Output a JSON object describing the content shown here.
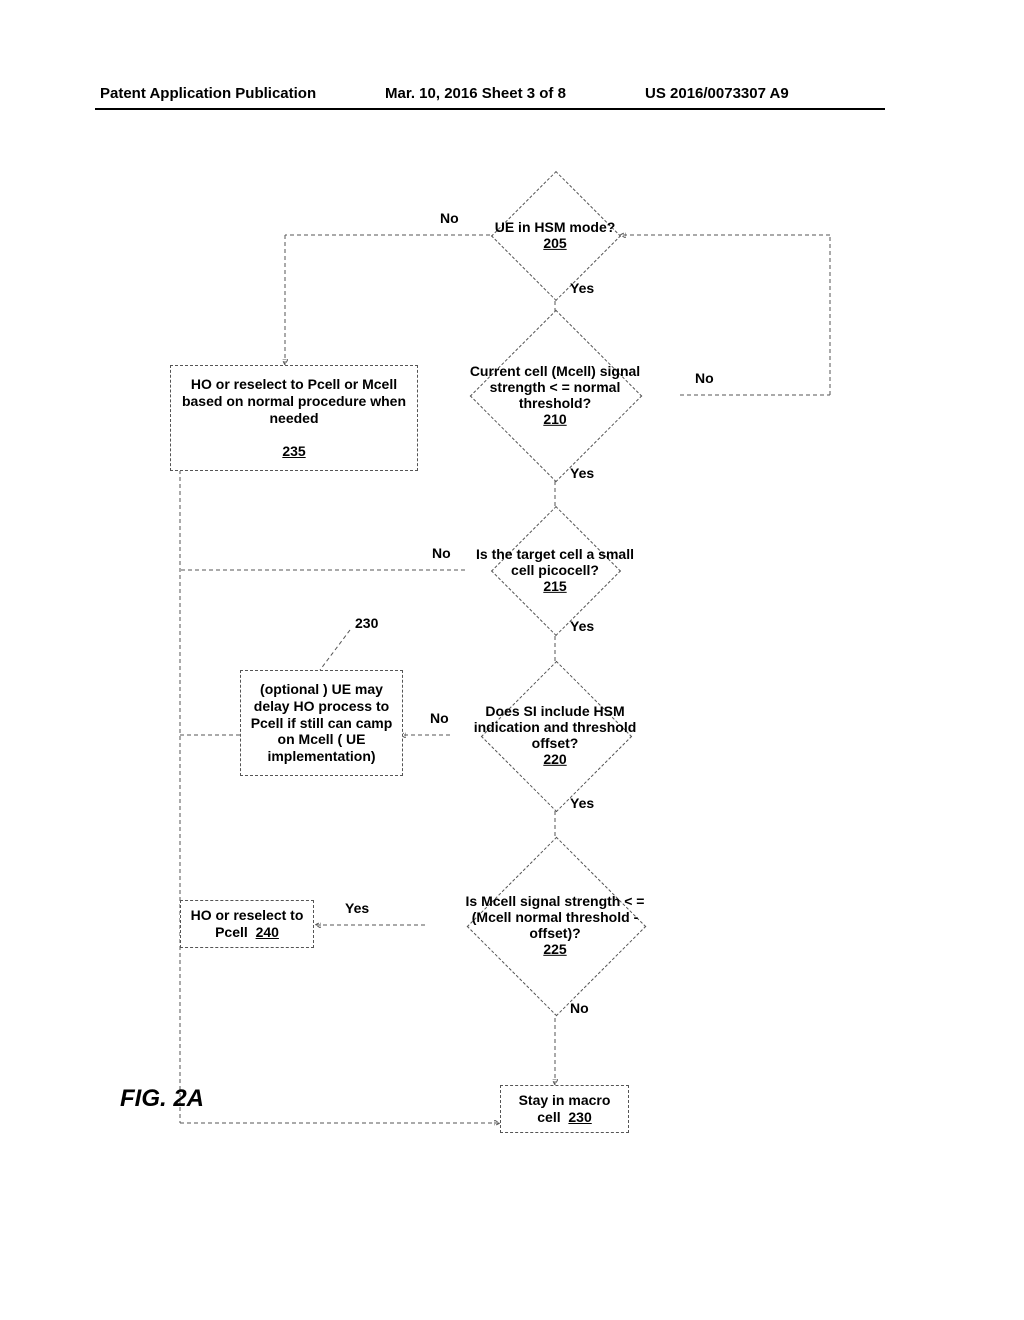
{
  "header": {
    "left": "Patent Application Publication",
    "center": "Mar. 10, 2016  Sheet 3 of 8",
    "right": "US 2016/0073307 A9"
  },
  "figure_label": "FIG. 2A",
  "labels": {
    "no": "No",
    "yes": "Yes",
    "ref230_pointer": "230"
  },
  "nodes": {
    "d205": {
      "text": "UE in HSM mode?",
      "ref": "205"
    },
    "d210": {
      "text": "Current cell (Mcell) signal strength  < = normal threshold?",
      "ref": "210"
    },
    "d215": {
      "text": "Is the target cell a small cell picocell?",
      "ref": "215"
    },
    "d220": {
      "text": "Does SI include HSM indication and threshold offset?",
      "ref": "220"
    },
    "d225": {
      "text": "Is Mcell signal strength  <  = (Mcell normal threshold - offset)?",
      "ref": "225"
    },
    "b235": {
      "text": "HO or reselect to Pcell or Mcell based on normal procedure when needed",
      "ref": "235"
    },
    "b230opt": {
      "text": "(optional ) UE may delay HO process to Pcell if still can camp on Mcell ( UE implementation)"
    },
    "b240": {
      "text": "HO or reselect to Pcell",
      "ref": "240"
    },
    "b230": {
      "text": "Stay in macro cell",
      "ref": "230"
    }
  }
}
